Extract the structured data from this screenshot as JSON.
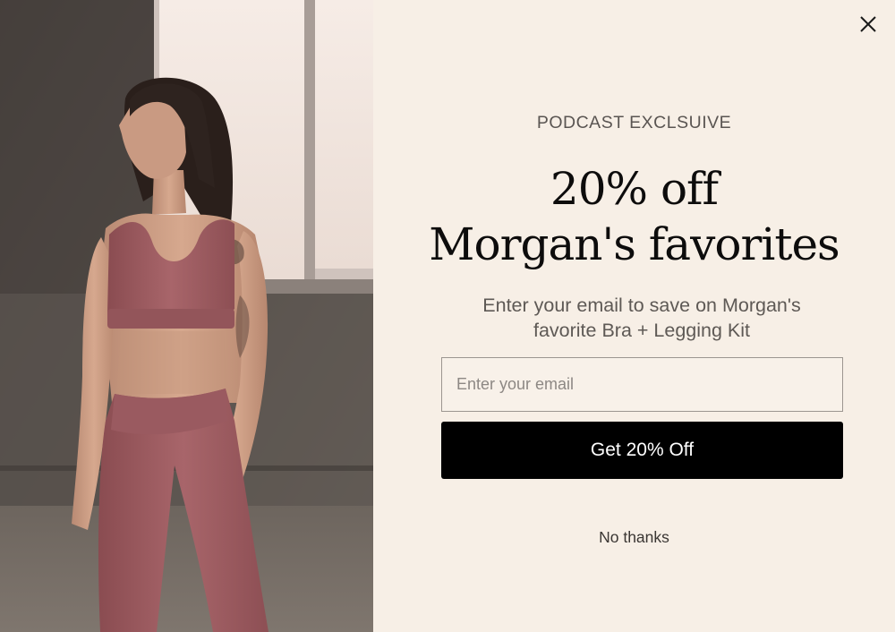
{
  "popup": {
    "eyebrow": "PODCAST EXCLSUIVE",
    "headline_line1": "20% off",
    "headline_line2": "Morgan's favorites",
    "subtext": "Enter your email to save on Morgan's favorite Bra + Legging Kit",
    "email_placeholder": "Enter your email",
    "cta_label": "Get 20% Off",
    "dismiss_label": "No thanks",
    "close_icon": "close-icon"
  },
  "colors": {
    "panel_bg": "#f7efe6",
    "cta_bg": "#000000",
    "cta_text": "#ffffff",
    "outfit": "#a15e62"
  }
}
